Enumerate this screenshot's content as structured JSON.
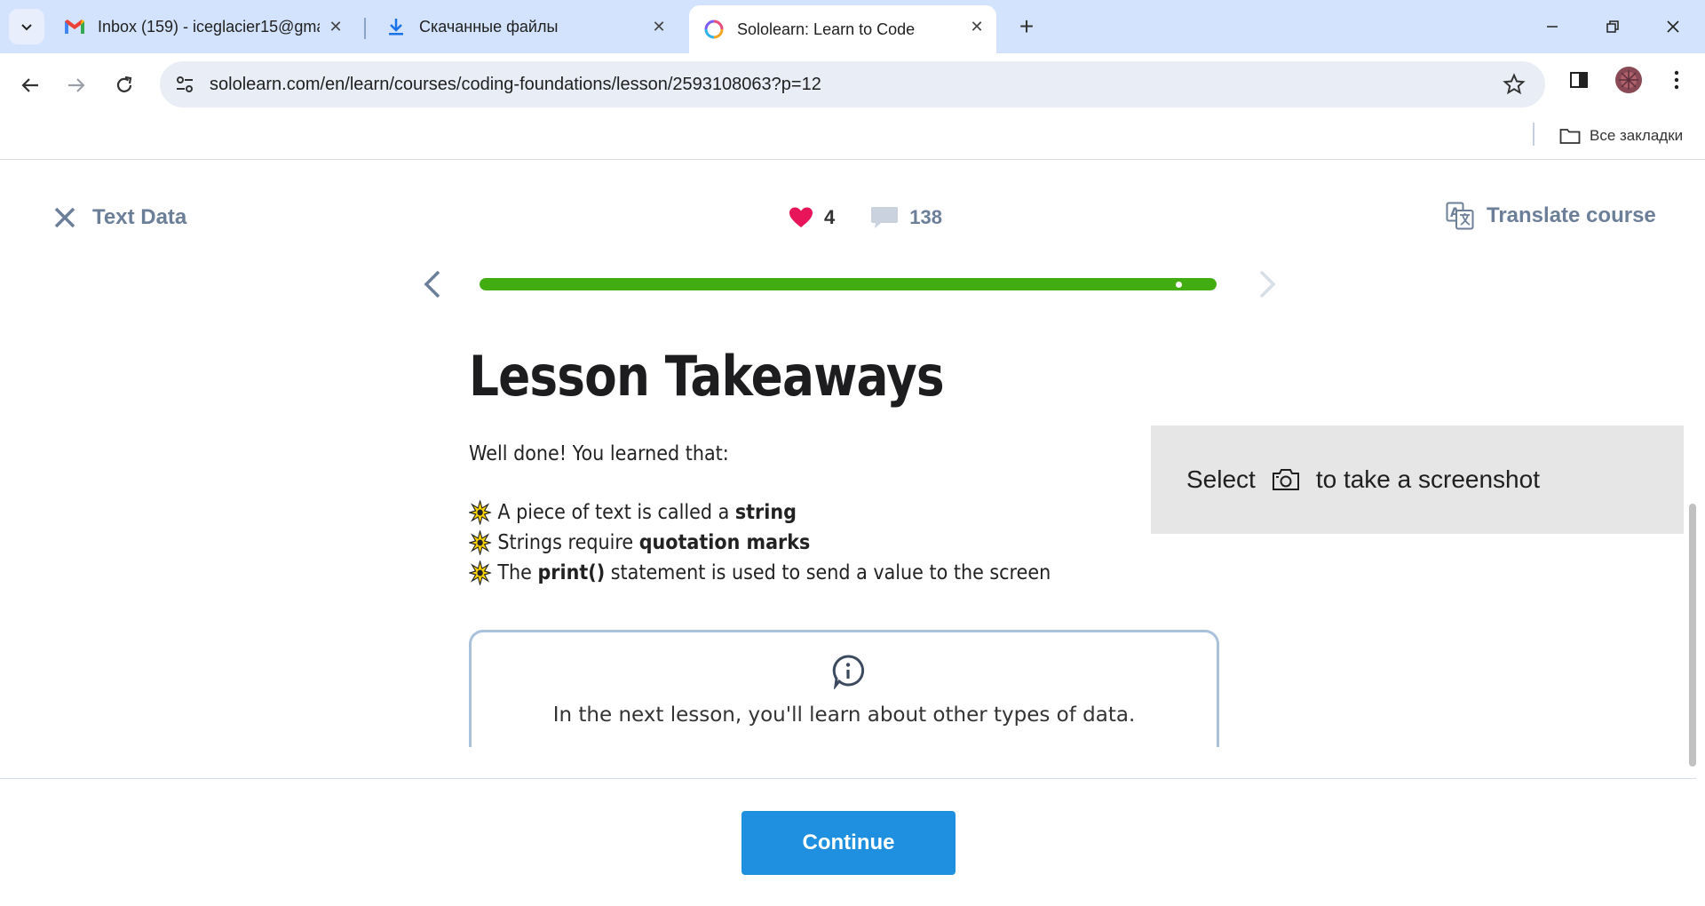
{
  "browser": {
    "tabs": [
      {
        "title": "Inbox (159) - iceglacier15@gma",
        "favicon": "gmail-icon"
      },
      {
        "title": "Скачанные файлы",
        "favicon": "download-icon"
      },
      {
        "title": "Sololearn: Learn to Code",
        "favicon": "sololearn-icon",
        "active": true
      }
    ],
    "url": "sololearn.com/en/learn/courses/coding-foundations/lesson/2593108063?p=12",
    "bookmarks_all": "Все закладки"
  },
  "lesson": {
    "name": "Text Data",
    "hearts": "4",
    "comments": "138",
    "translate": "Translate course",
    "progress_fraction": 1.0,
    "title": "Lesson Takeaways",
    "intro": "Well done! You learned that:",
    "bullets": [
      {
        "pre": "A piece of text is called a ",
        "bold": "string",
        "post": ""
      },
      {
        "pre": "Strings require ",
        "bold": "quotation marks",
        "post": ""
      },
      {
        "pre": "The ",
        "bold": "print()",
        "post": " statement is used to send a value to the screen"
      }
    ],
    "info": "In the next lesson, you'll learn about other types of data.",
    "continue": "Continue"
  },
  "overlay": {
    "select": "Select",
    "suffix": "to take a screenshot"
  },
  "colors": {
    "progress": "#41ad10",
    "heart": "#e8155a",
    "continue": "#1e90df",
    "muted": "#6b7f99"
  }
}
